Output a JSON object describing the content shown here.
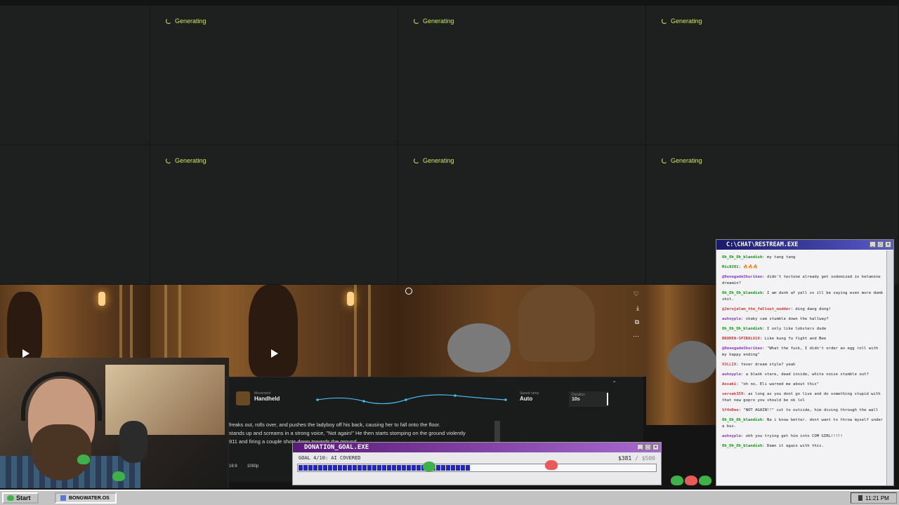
{
  "tiles": {
    "status_label": "Generating"
  },
  "prompt_panel": {
    "movement_label": "Movement",
    "movement_value": "Handheld",
    "speed_label": "Speed ramp",
    "speed_value": "Auto",
    "duration_label": "Duration",
    "duration_value": "10s",
    "prompt_lines": [
      "freaks out, rolls over, and pushes the ladyboy off his back, causing her to fall onto the floor.",
      "stands up and screams in a strong voice, \"Not again!\" He then starts stomping on the ground violently",
      "911 and firing a couple shots down towards the ground"
    ],
    "aspect": "16:9",
    "resolution": "1080p"
  },
  "donation": {
    "title": "DONATION_GOAL.EXE",
    "goal_text": "GOAL 4/10: AI COVERED",
    "amount_current": "$381",
    "amount_sep": "/",
    "amount_target": "$500",
    "progress": 0.48
  },
  "chat": {
    "title": "C:\\CHAT\\RESTREAM.EXE",
    "messages": [
      {
        "user": "Oh_Oh_Oh_blandish",
        "text": "my tang tang",
        "color": "#1a8a1a"
      },
      {
        "user": "Mic8201",
        "text": "🔥🔥🔥",
        "color": "#1a8a1a"
      },
      {
        "user": "@RenegadeShuriken",
        "text": "didn't tectone already get sodomized in ketamine dreamin?",
        "color": "#8a3ac8"
      },
      {
        "user": "Oh_Oh_Oh_blandish",
        "text": "I am dunk af yall so ill be saying even more dumb shit.",
        "color": "#1a8a1a"
      },
      {
        "user": "@Jerujalem_the_fallout_modder",
        "text": "ding dang dong!",
        "color": "#c83a3a"
      },
      {
        "user": "auhnyple",
        "text": "shaky cam stumble down the hallway?",
        "color": "#8a3ac8"
      },
      {
        "user": "Oh_Oh_Oh_blandish",
        "text": "I only like lobsters dude",
        "color": "#1a8a1a"
      },
      {
        "user": "BROKEN-SPIRAL619",
        "text": "Like kung fu fight and Bee",
        "color": "#c83a3a"
      },
      {
        "user": "@RenegadeShuriken",
        "text": "\"What the fuck, I didn't order an egg roll with my happy ending\"",
        "color": "#8a3ac8"
      },
      {
        "user": "X3LLIX",
        "text": "fever dream style? yeah",
        "color": "#c83a3a"
      },
      {
        "user": "auhnyple",
        "text": "a blank stare, dead inside, white noise stumble out?",
        "color": "#8a3ac8"
      },
      {
        "user": "Aosaki",
        "text": "\"oh no, Eli warned me about this\"",
        "color": "#c83a3a"
      },
      {
        "user": "servak359",
        "text": "as long as you dont go live and do something stupid with that new gopro you should be ok lol",
        "color": "#c83a3a"
      },
      {
        "user": "Sf4nDee",
        "text": "\"NOT AGAIN!!\" cut to outside, him diving through the wall",
        "color": "#c83a3a"
      },
      {
        "user": "Oh_Oh_Oh_blandish",
        "text": "Na i know better. dont want to throw myself under a bus.",
        "color": "#1a8a1a"
      },
      {
        "user": "auhnyple",
        "text": "ohh you trying get him into COM GIRL!!!!!",
        "color": "#8a3ac8"
      },
      {
        "user": "Oh_Oh_Oh_blandish",
        "text": "Damn it again with this.",
        "color": "#1a8a1a"
      }
    ]
  },
  "taskbar": {
    "start_label": "Start",
    "app_label": "BONGWATER.OS",
    "clock": "11:21 PM"
  }
}
